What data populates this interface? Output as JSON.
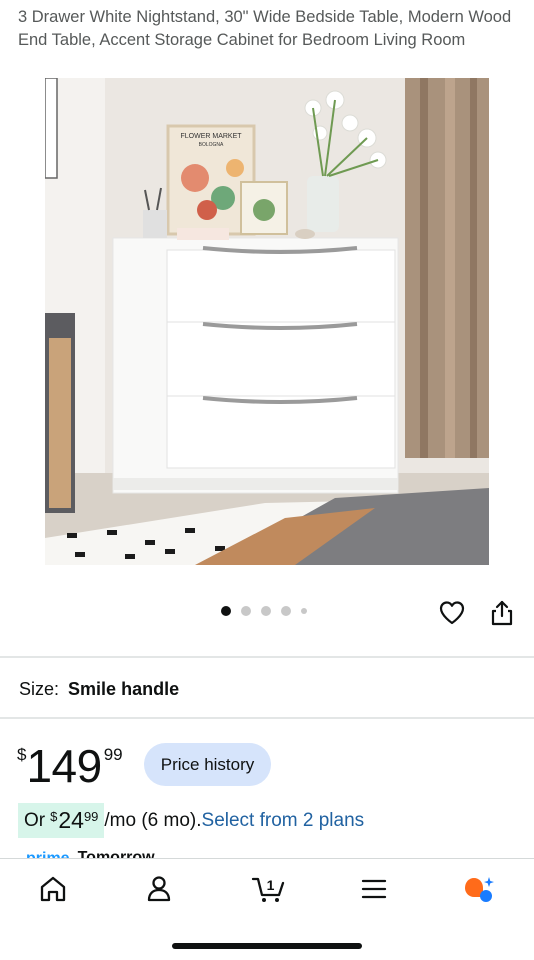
{
  "product": {
    "title": "3 Drawer White Nightstand, 30\" Wide Bedside Table, Modern Wood End Table, Accent Storage Cabinet for Bedroom Living Room"
  },
  "gallery": {
    "dot_count": 5,
    "active_index": 0,
    "poster_text": "FLOWER MARKET",
    "poster_subtext": "BOLOGNA"
  },
  "size": {
    "label": "Size:",
    "value": "Smile handle"
  },
  "price": {
    "currency": "$",
    "whole": "149",
    "fraction": "99",
    "history_button": "Price history"
  },
  "installment": {
    "prefix": "Or",
    "currency": "$",
    "whole": "24",
    "fraction": "99",
    "suffix": "/mo (6 mo).",
    "link": "Select from 2 plans"
  },
  "delivery": {
    "prime_label": "prime",
    "day": "Tomorrow"
  },
  "nav": {
    "cart_count": "1"
  },
  "colors": {
    "link": "#2162a1",
    "price_history_bg": "#d6e4fb",
    "installment_bg": "#d7f5ea",
    "assistant_orange": "#ff6b1a",
    "assistant_blue": "#1a7cff"
  }
}
